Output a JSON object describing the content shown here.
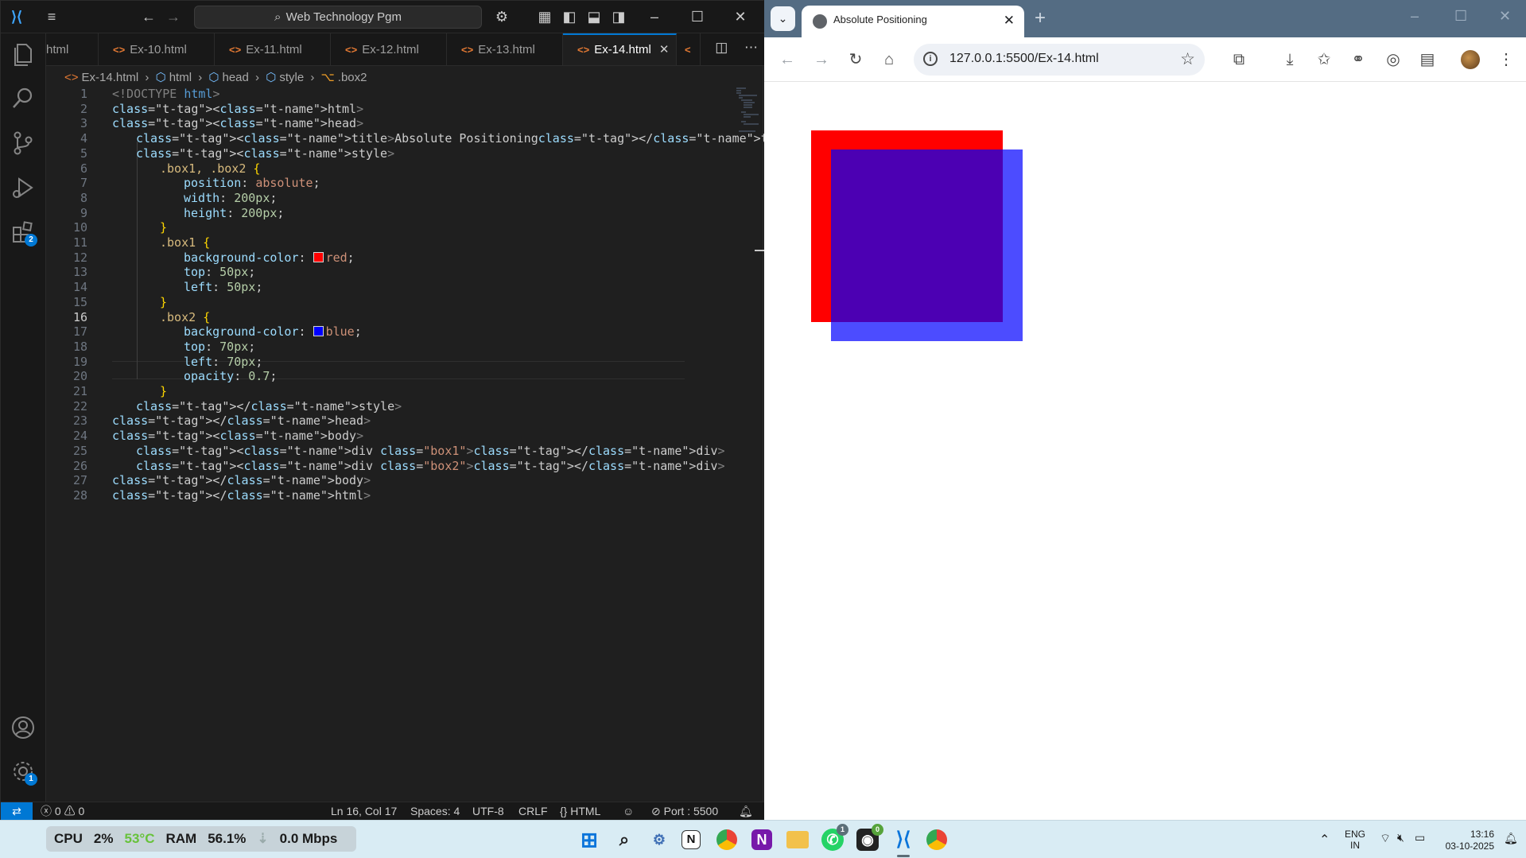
{
  "vscode": {
    "search_text": "Web Technology Pgm",
    "tabs": [
      {
        "label": "html"
      },
      {
        "label": "Ex-10.html"
      },
      {
        "label": "Ex-11.html"
      },
      {
        "label": "Ex-12.html"
      },
      {
        "label": "Ex-13.html"
      },
      {
        "label": "Ex-14.html",
        "active": true
      }
    ],
    "breadcrumb": [
      "Ex-14.html",
      "html",
      "head",
      "style",
      ".box2"
    ],
    "activity_badges": {
      "extensions": "2",
      "settings": "1"
    },
    "current_line": 16,
    "lines": [
      "<!DOCTYPE html>",
      "<html>",
      "<head>",
      "<title>Absolute Positioning</title>",
      "<style>",
      ".box1, .box2 {",
      "position: absolute;",
      "width: 200px;",
      "height: 200px;",
      "}",
      ".box1 {",
      "background-color: red;",
      "top: 50px;",
      "left: 50px;",
      "}",
      ".box2 {",
      "background-color: blue;",
      "top: 70px;",
      "left: 70px;",
      "opacity: 0.7;",
      "}",
      "</style>",
      "</head>",
      "<body>",
      "<div class=\"box1\"></div>",
      "<div class=\"box2\"></div>",
      "</body>",
      "</html>"
    ],
    "status": {
      "errors": "0",
      "warnings": "0",
      "cursor": "Ln 16, Col 17",
      "spaces": "Spaces: 4",
      "encoding": "UTF-8",
      "eol": "CRLF",
      "language": "HTML",
      "port": "Port : 5500"
    }
  },
  "chrome": {
    "tab_title": "Absolute Positioning",
    "url": "127.0.0.1:5500/Ex-14.html",
    "page": {
      "box1_color": "#ff0000",
      "box2_color": "#0000ff",
      "box2_opacity": 0.7
    }
  },
  "taskbar": {
    "cpu_label": "CPU",
    "cpu_value": "2%",
    "temp": "53°C",
    "ram_label": "RAM",
    "ram_value": "56.1%",
    "net": "0.0 Mbps",
    "lang": "ENG",
    "region": "IN",
    "time": "13:16",
    "date": "03-10-2025",
    "whatsapp_badge": "1",
    "github_badge": "0"
  }
}
